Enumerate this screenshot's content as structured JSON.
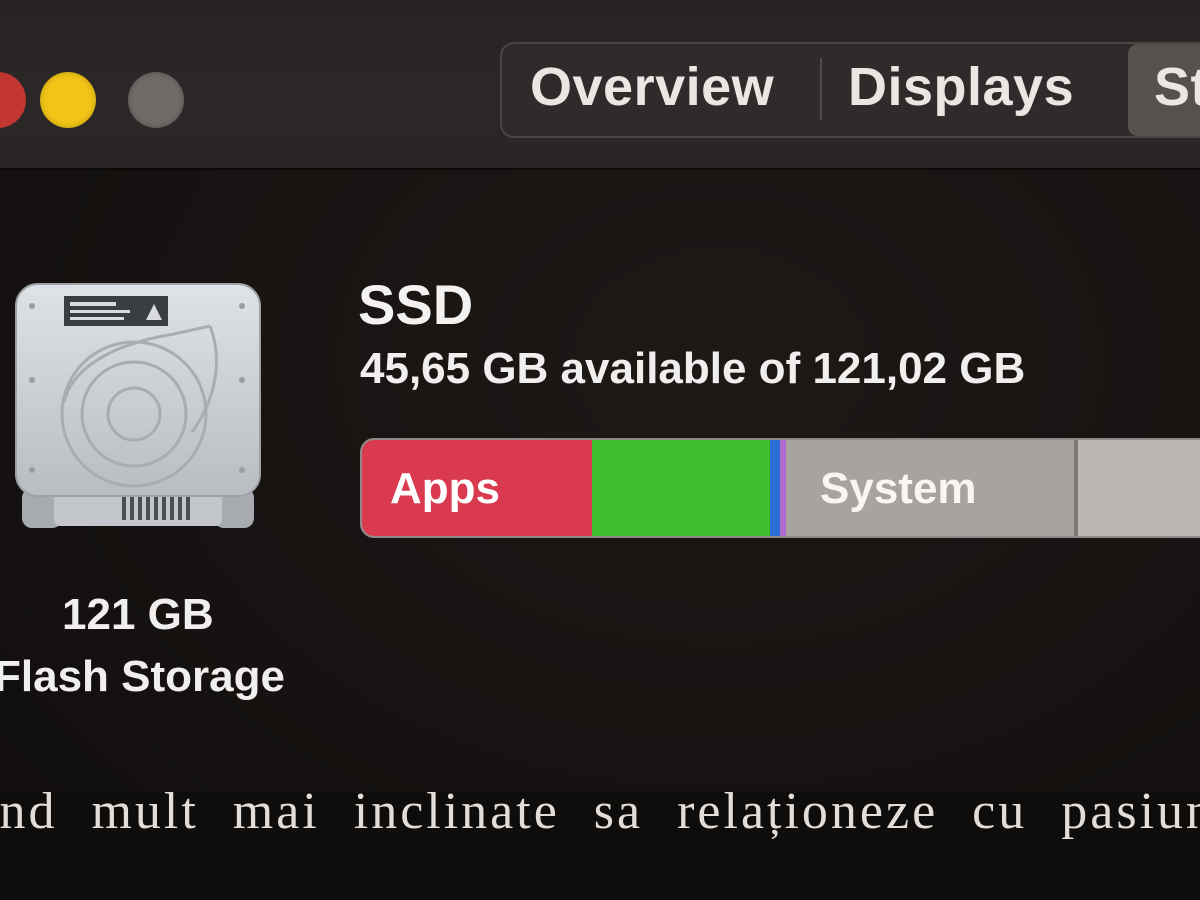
{
  "window": {
    "controls": [
      "close-button",
      "minimize-button",
      "zoom-button"
    ],
    "tabs": [
      {
        "label": "Overview"
      },
      {
        "label": "Displays"
      },
      {
        "label": "St"
      }
    ]
  },
  "device": {
    "icon": "hard-drive-icon",
    "size_label": "121 GB",
    "type_label": "Flash Storage"
  },
  "disk": {
    "name": "SSD",
    "availability": "45,65 GB available of 121,02 GB"
  },
  "usage_bar": {
    "segments": [
      {
        "label": "Apps",
        "color": "#d93a4f"
      },
      {
        "label": "",
        "color": "#3fbf2e"
      },
      {
        "label": "",
        "color": "#2a6fd6"
      },
      {
        "label": "",
        "color": "#b06ad0"
      },
      {
        "label": "System",
        "color": "#a8a39f"
      },
      {
        "label": "",
        "color": "#bcb7b3"
      }
    ]
  },
  "background_text": "ind mult mai inclinate sa relaționeze cu pasiunn"
}
